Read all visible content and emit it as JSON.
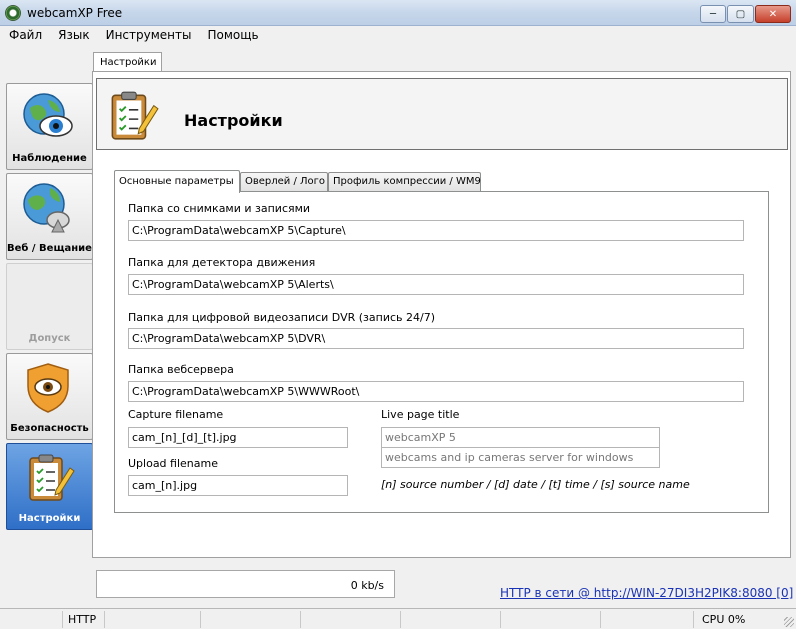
{
  "window": {
    "title": "webcamXP Free",
    "min": "─",
    "max": "▢",
    "close": "✕"
  },
  "menu": [
    "Файл",
    "Язык",
    "Инструменты",
    "Помощь"
  ],
  "nav": [
    {
      "label": "Наблюдение",
      "icon": "globe-eye-icon",
      "state": "normal"
    },
    {
      "label": "Веб / Вещание",
      "icon": "globe-antenna-icon",
      "state": "normal"
    },
    {
      "label": "Допуск",
      "icon": "",
      "state": "disabled"
    },
    {
      "label": "Безопасность",
      "icon": "shield-eye-icon",
      "state": "normal"
    },
    {
      "label": "Настройки",
      "icon": "clipboard-pencil-icon",
      "state": "active"
    }
  ],
  "breadcrumb": "Настройки",
  "header": {
    "title": "Настройки"
  },
  "tabs": [
    "Основные параметры",
    "Оверлей / Лого",
    "Профиль компрессии / WM9"
  ],
  "settings": {
    "capture_folder": {
      "label": "Папка со снимками и записями",
      "value": "C:\\ProgramData\\webcamXP 5\\Capture\\"
    },
    "motion_folder": {
      "label": "Папка для детектора движения",
      "value": "C:\\ProgramData\\webcamXP 5\\Alerts\\"
    },
    "dvr_folder": {
      "label": "Папка для цифровой видеозаписи DVR (запись 24/7)",
      "value": "C:\\ProgramData\\webcamXP 5\\DVR\\"
    },
    "webserver_folder": {
      "label": "Папка вебсервера",
      "value": "C:\\ProgramData\\webcamXP 5\\WWWRoot\\"
    },
    "capture_filename": {
      "label": "Capture filename",
      "value": "cam_[n]_[d]_[t].jpg"
    },
    "upload_filename": {
      "label": "Upload filename",
      "value": "cam_[n].jpg"
    },
    "live_page_title": {
      "label": "Live page title",
      "value1": "webcamXP 5",
      "value2": "webcams and ip cameras server for windows"
    },
    "hint": "[n] source number / [d] date / [t] time / [s] source name"
  },
  "bandwidth": "0 kb/s",
  "http_status": "HTTP в сети @ http://WIN-27DI3H2PIK8:8080 [0]",
  "statusbar": {
    "protocol": "HTTP",
    "cpu": "CPU 0%"
  },
  "colors": {
    "active_nav": "#2f6fc7",
    "link": "#1a33b5"
  }
}
